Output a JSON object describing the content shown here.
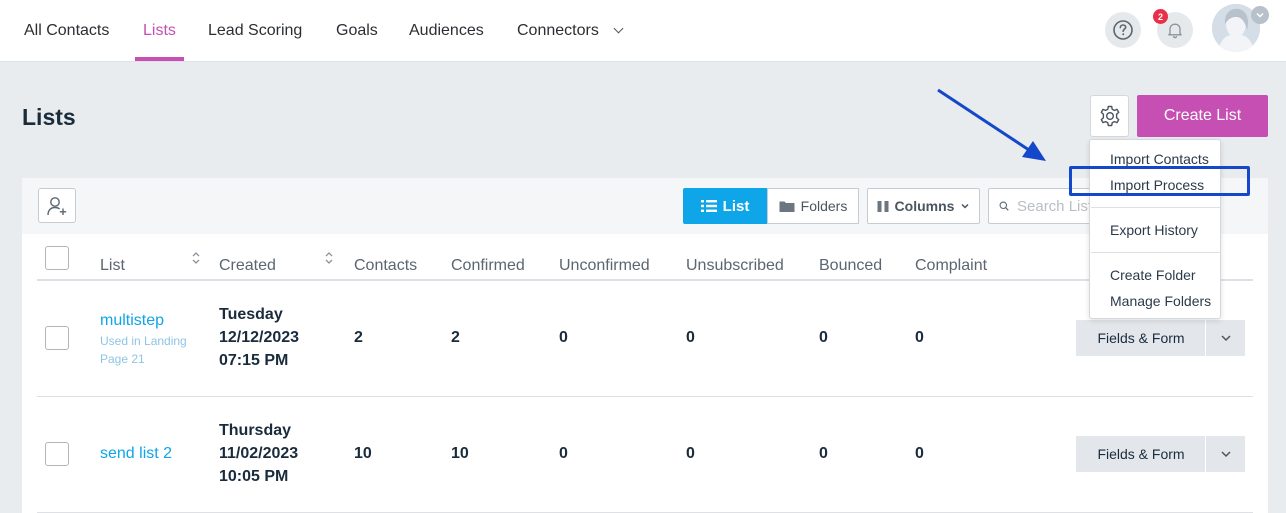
{
  "nav": {
    "tabs": [
      {
        "label": "All Contacts"
      },
      {
        "label": "Lists"
      },
      {
        "label": "Lead Scoring"
      },
      {
        "label": "Goals"
      },
      {
        "label": "Audiences"
      },
      {
        "label": "Connectors"
      }
    ],
    "active_tab": "Lists",
    "notification_count": "2",
    "help_icon": "question-circle-icon",
    "bell_icon": "bell-icon"
  },
  "page": {
    "title": "Lists",
    "create_button": "Create List",
    "settings_icon": "gear-icon"
  },
  "toolbar": {
    "view_list": "List",
    "view_folders": "Folders",
    "columns": "Columns",
    "search_placeholder": "Search Lists"
  },
  "table": {
    "headers": [
      "List",
      "Created",
      "Contacts",
      "Confirmed",
      "Unconfirmed",
      "Unsubscribed",
      "Bounced",
      "Complaint"
    ],
    "rows": [
      {
        "name": "multistep",
        "sub": "Used in Landing Page 21",
        "created_day": "Tuesday",
        "created_date": "12/12/2023",
        "created_time": "07:15 PM",
        "contacts": "2",
        "confirmed": "2",
        "unconfirmed": "0",
        "unsubscribed": "0",
        "bounced": "0",
        "complaint": "0",
        "action": "Fields & Form"
      },
      {
        "name": "send list 2",
        "sub": "",
        "created_day": "Thursday",
        "created_date": "11/02/2023",
        "created_time": "10:05 PM",
        "contacts": "10",
        "confirmed": "10",
        "unconfirmed": "0",
        "unsubscribed": "0",
        "bounced": "0",
        "complaint": "0",
        "action": "Fields & Form"
      }
    ]
  },
  "menu": {
    "items": [
      "Import Contacts",
      "Import Process",
      "Export History",
      "Create Folder",
      "Manage Folders"
    ],
    "highlighted": "Import Process"
  },
  "colors": {
    "brand": "#c64fb3",
    "accent": "#0ea5e9",
    "annotation": "#1447c9"
  }
}
